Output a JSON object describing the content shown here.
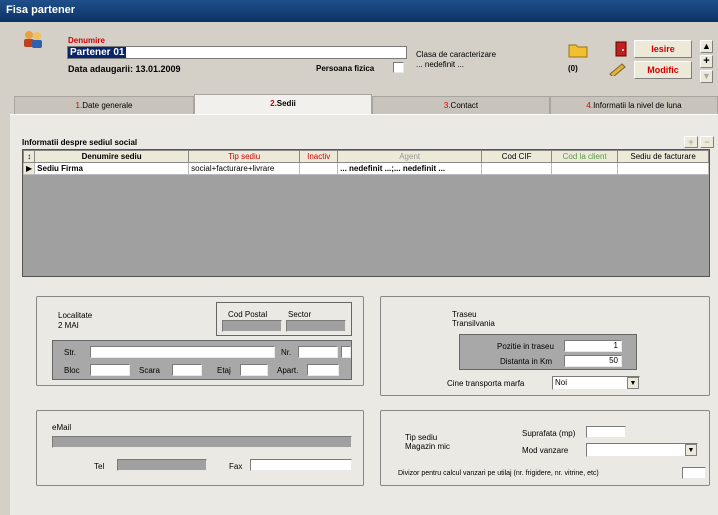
{
  "window": {
    "title": "Fisa partener"
  },
  "header": {
    "name_label": "Denumire",
    "partner_name": "Partener 01",
    "date_added": "Data adaugarii: 13.01.2009",
    "person_type_label": "Persoana fizica",
    "class_label": "Clasa de caracterizare",
    "class_value": "... nedefinit ...",
    "doc_count": "(0)",
    "exit_label": "Iesire",
    "modify_label": "Modific"
  },
  "tabs": [
    {
      "num": "1.",
      "label": "Date generale"
    },
    {
      "num": "2.",
      "label": "Sedii"
    },
    {
      "num": "3.",
      "label": "Contact"
    },
    {
      "num": "4.",
      "label": "Informatii la nivel de luna"
    }
  ],
  "grid": {
    "title": "Informatii despre sediul social",
    "columns": [
      "↕",
      "Denumire sediu",
      "Tip sediu",
      "Inactiv",
      "Agent",
      "Cod CIF",
      "Cod la client",
      "Sediu de facturare"
    ],
    "rows": [
      [
        "▶",
        "Sediu Firma",
        "social+facturare+livrare",
        "",
        "... nedefinit ...;... nedefinit ...",
        "",
        "",
        ""
      ]
    ]
  },
  "address": {
    "locality_label": "Localitate",
    "locality_value": "2 MAI",
    "postal_code_label": "Cod Postal",
    "sector_label": "Sector",
    "street_label": "Str.",
    "number_label": "Nr.",
    "block_label": "Bloc",
    "stair_label": "Scara",
    "floor_label": "Etaj",
    "apartment_label": "Apart."
  },
  "route": {
    "label": "Traseu",
    "value": "Transilvania",
    "position_label": "Pozitie in traseu",
    "position_value": "1",
    "distance_label": "Distanta in Km",
    "distance_value": "50",
    "transport_label": "Cine transporta marfa",
    "transport_value": "Noi"
  },
  "contact": {
    "email_label": "eMail",
    "phone_label": "Tel",
    "fax_label": "Fax"
  },
  "store": {
    "type_label": "Tip sediu",
    "type_value": "Magazin mic",
    "area_label": "Suprafata (mp)",
    "sales_mode_label": "Mod vanzare",
    "divisor_label": "Divizor pentru calcul vanzari pe utilaj   (nr. frigidere, nr. vitrine, etc)"
  }
}
